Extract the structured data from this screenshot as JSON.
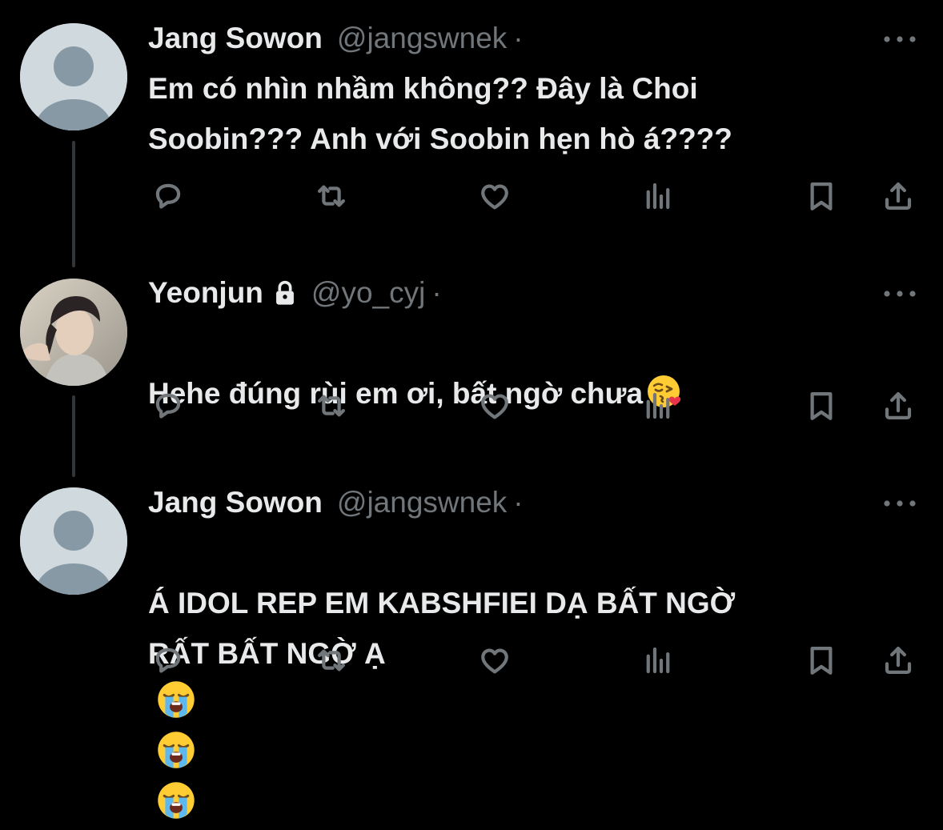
{
  "tweets": [
    {
      "name": "Jang Sowon",
      "handle": "@jangswnek",
      "separator": "·",
      "locked": false,
      "avatar": "default-avatar",
      "text": "Em có nhìn nhầm không?? Đây là Choi\nSoobin??? Anh với Soobin hẹn hò á????",
      "emojis": []
    },
    {
      "name": "Yeonjun",
      "handle": "@yo_cyj",
      "separator": "·",
      "locked": true,
      "avatar": "photo-avatar",
      "text": "Hehe đúng rùi em ơi, bất ngờ chưa",
      "emojis": [
        "face-blowing-kiss"
      ]
    },
    {
      "name": "Jang Sowon",
      "handle": "@jangswnek",
      "separator": "·",
      "locked": false,
      "avatar": "default-avatar",
      "text": "Á IDOL REP EM KABSHFIEI DẠ BẤT NGỜ\nRẤT BẤT NGỜ Ạ",
      "emojis": [
        "loudly-crying-face",
        "loudly-crying-face",
        "loudly-crying-face"
      ]
    }
  ],
  "action_icons": [
    "reply-icon",
    "retweet-icon",
    "like-icon",
    "views-icon",
    "bookmark-icon",
    "share-icon"
  ],
  "colors": {
    "background": "#000000",
    "text": "#e7e9ea",
    "muted": "#71767b",
    "thread_line": "#333639",
    "default_avatar": "#cfd9de"
  }
}
